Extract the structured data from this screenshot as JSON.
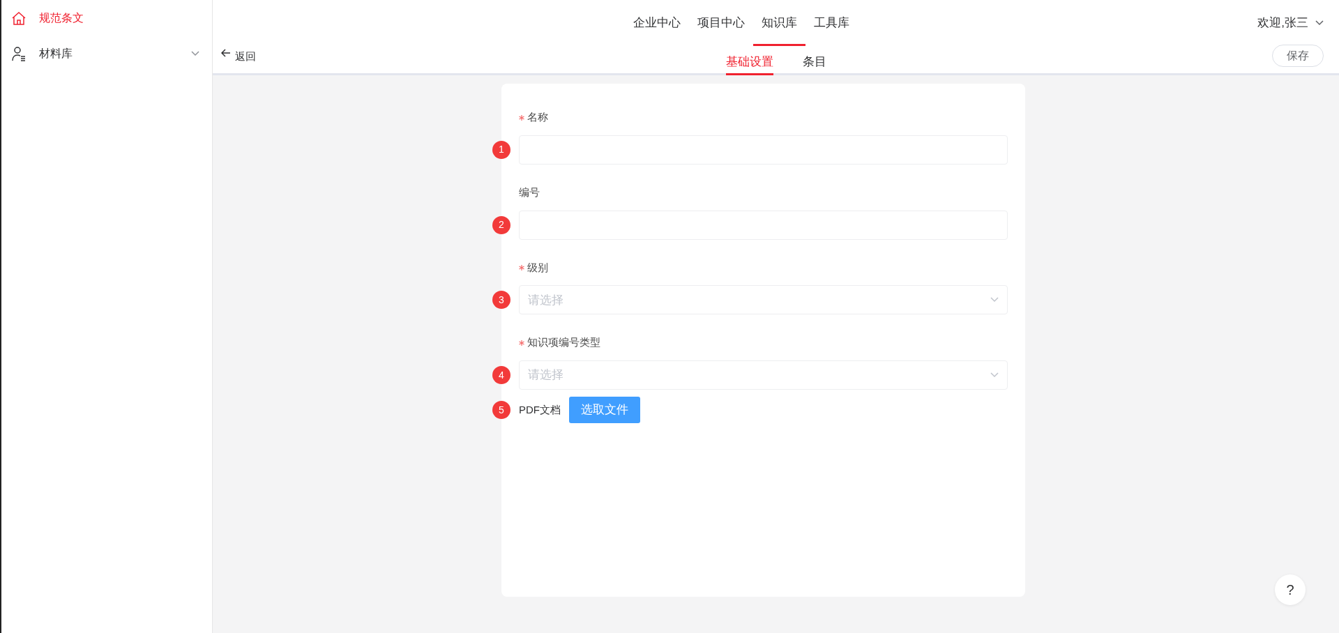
{
  "sidebar": {
    "items": [
      {
        "label": "规范条文",
        "selected": true
      },
      {
        "label": "材料库",
        "selected": false,
        "expanded": false
      }
    ]
  },
  "top_nav": {
    "items": [
      {
        "label": "企业中心",
        "selected": false
      },
      {
        "label": "项目中心",
        "selected": false
      },
      {
        "label": "知识库",
        "selected": true
      },
      {
        "label": "工具库",
        "selected": false
      }
    ],
    "user": "欢迎,张三"
  },
  "toolbar": {
    "back": "返回",
    "tabs": [
      {
        "label": "基础设置",
        "selected": true
      },
      {
        "label": "条目",
        "selected": false
      }
    ],
    "save": "保存"
  },
  "form": {
    "fields": [
      {
        "kind": "text",
        "step": "1",
        "label": "名称",
        "required": true
      },
      {
        "kind": "text",
        "step": "2",
        "label": "编号",
        "required": false
      },
      {
        "kind": "select",
        "step": "3",
        "label": "级别",
        "required": true,
        "placeholder": "请选择"
      },
      {
        "kind": "select",
        "step": "4",
        "label": "知识项编号类型",
        "required": true,
        "placeholder": "请选择"
      },
      {
        "kind": "file",
        "step": "5",
        "label": "PDF文档",
        "button": "选取文件"
      }
    ]
  },
  "help": "?"
}
